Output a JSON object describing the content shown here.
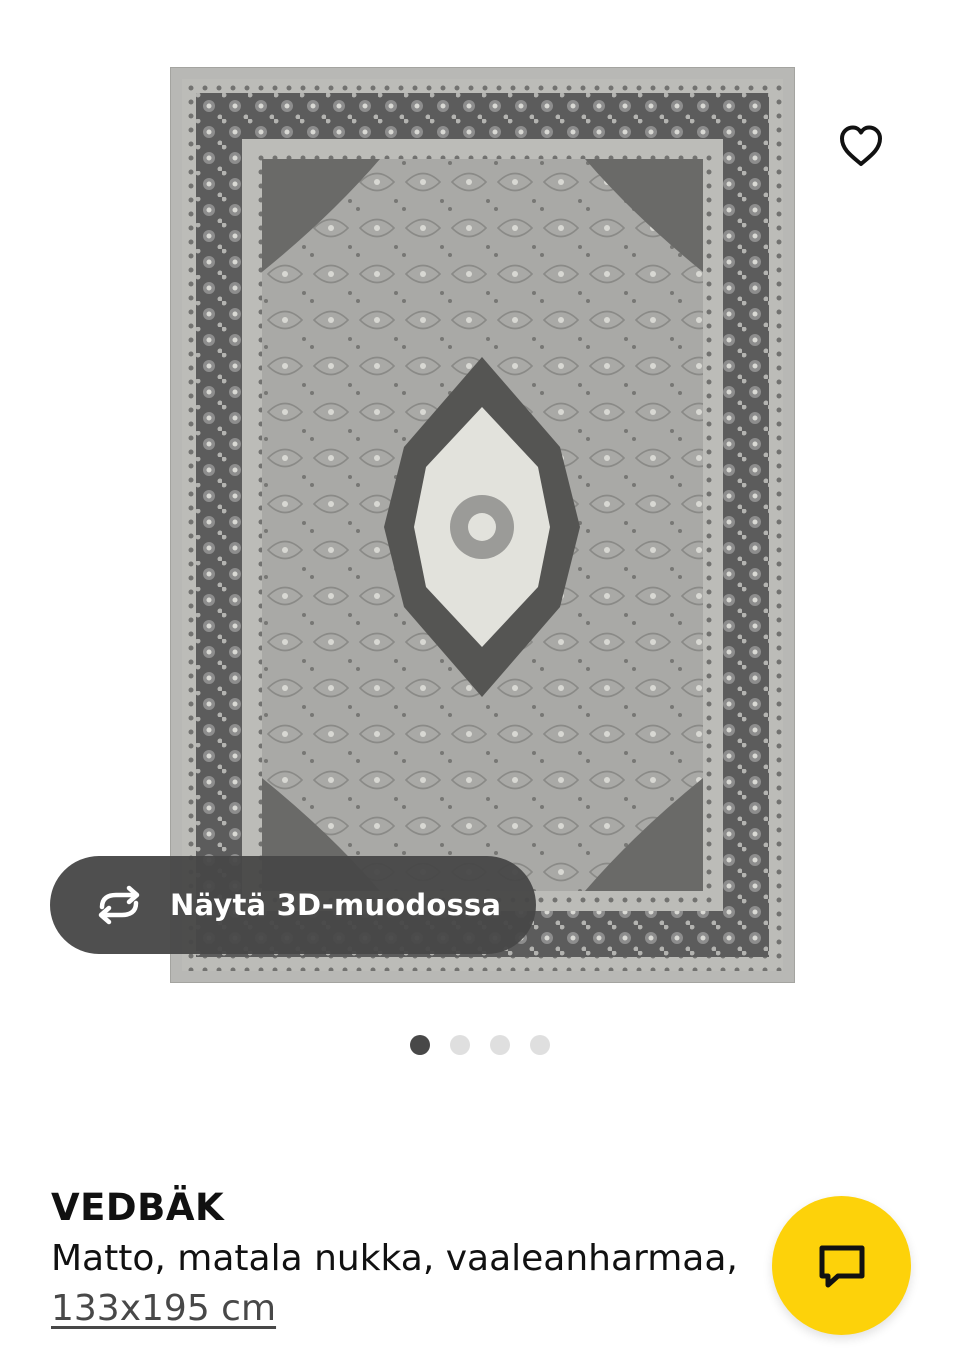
{
  "product": {
    "name": "VEDBÄK",
    "description": "Matto, matala nukka, vaaleanharmaa,",
    "size": "133x195 cm"
  },
  "gallery": {
    "view_3d_label": "Näytä 3D-muodossa",
    "dot_count": 4,
    "active_index": 0
  },
  "icons": {
    "favorite": "heart-icon",
    "view_3d": "rotate-3d-icon",
    "chat": "chat-bubble-icon"
  },
  "colors": {
    "accent": "#fdd20a",
    "pill": "#484848",
    "text": "#111111",
    "dot_active": "#484848",
    "dot_inactive": "#dfdfdf"
  }
}
